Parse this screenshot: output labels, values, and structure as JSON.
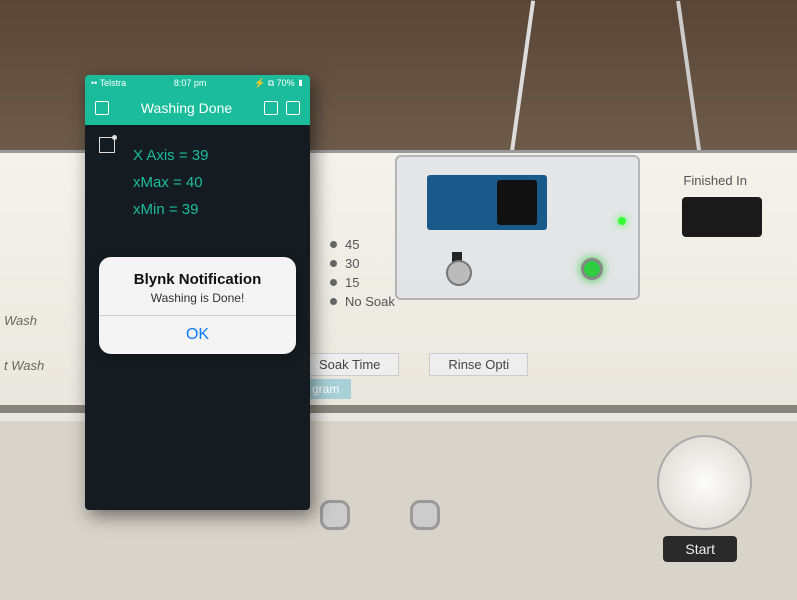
{
  "phone": {
    "status_left": "•• Telstra",
    "status_time": "8:07 pm",
    "status_right": "⚡ ⧉ 70% ▮",
    "app_title": "Washing Done",
    "lines": {
      "x_axis": "X Axis = 39",
      "x_max": "xMax = 40",
      "x_min": "xMin = 39"
    },
    "alert": {
      "title": "Blynk Notification",
      "message": "Washing is Done!",
      "ok": "OK"
    }
  },
  "machine": {
    "wash_label": "Wash",
    "t_wash_label": "t Wash",
    "finished_label": "Finished In",
    "soak_options": [
      "45",
      "30",
      "15",
      "No Soak"
    ],
    "btn_soak": "Soak Time",
    "btn_rinse": "Rinse Opti",
    "gram": "gram",
    "start": "Start"
  }
}
